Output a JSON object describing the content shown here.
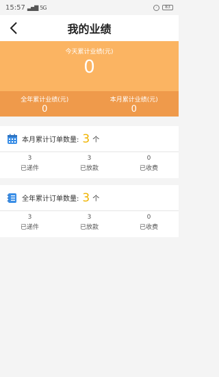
{
  "status_bar": {
    "time": "15:57",
    "signal": "▃▅▇",
    "network": "5G",
    "battery": "83"
  },
  "nav": {
    "title": "我的业绩"
  },
  "hero": {
    "today_label": "今天累计业绩(元)",
    "today_value": "0",
    "year_label": "全年累计业绩(元)",
    "year_value": "0",
    "month_label": "本月累计业绩(元)",
    "month_value": "0"
  },
  "month_orders": {
    "title": "本月累计订单数量:",
    "count": "3",
    "unit": "个",
    "stats": [
      {
        "value": "3",
        "label": "已递件"
      },
      {
        "value": "3",
        "label": "已放款"
      },
      {
        "value": "0",
        "label": "已收费"
      }
    ]
  },
  "year_orders": {
    "title": "全年累计订单数量:",
    "count": "3",
    "unit": "个",
    "stats": [
      {
        "value": "3",
        "label": "已递件"
      },
      {
        "value": "3",
        "label": "已放款"
      },
      {
        "value": "0",
        "label": "已收费"
      }
    ]
  }
}
